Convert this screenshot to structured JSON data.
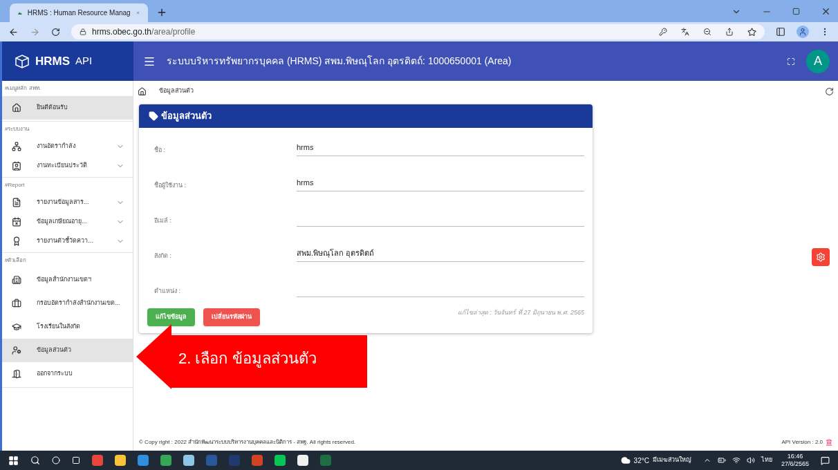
{
  "browser": {
    "tab_title": "HRMS : Human Resource Manag",
    "url_host": "hrms.obec.go.th",
    "url_path": "/area/profile"
  },
  "header": {
    "logo": "HRMS",
    "logo_suffix": "API",
    "title": "ระบบบริหารทรัพยากรบุคคล (HRMS) สพม.พิษณุโลก อุตรดิตถ์: 1000650001 (Area)",
    "avatar": "A"
  },
  "sidebar": [
    {
      "heading": "#เมนูหลัก สพท.",
      "items": [
        {
          "label": "ยินดีต้อนรับ",
          "selected": true,
          "expandable": false
        }
      ]
    },
    {
      "heading": "#ระบบงาน",
      "items": [
        {
          "label": "งานอัตรากำลัง",
          "selected": false,
          "expandable": true
        },
        {
          "label": "งานทะเบียนประวัติ",
          "selected": false,
          "expandable": true
        }
      ]
    },
    {
      "heading": "#Report",
      "items": [
        {
          "label": "รายงานข้อมูลสาร...",
          "selected": false,
          "expandable": true
        },
        {
          "label": "ข้อมูลเกษียณอายุ...",
          "selected": false,
          "expandable": true
        },
        {
          "label": "รายงานตัวชี้วัดควา...",
          "selected": false,
          "expandable": true
        }
      ]
    },
    {
      "heading": "#ตัวเลือก",
      "items": [
        {
          "label": "ข้อมูลสำนักงานเขตฯ",
          "selected": false,
          "expandable": false
        },
        {
          "label": "กรอบอัตรากำลังสำนักงานเขต...",
          "selected": false,
          "expandable": false
        },
        {
          "label": "โรงเรียนในสังกัด",
          "selected": false,
          "expandable": false
        },
        {
          "label": "ข้อมูลส่วนตัว",
          "selected": true,
          "expandable": false
        },
        {
          "label": "ออกจากระบบ",
          "selected": false,
          "expandable": false
        }
      ]
    }
  ],
  "breadcrumb": "ข้อมูลส่วนตัว",
  "card": {
    "title": "ข้อมูลส่วนตัว",
    "fields": [
      {
        "label": "ชื่อ :",
        "value": "hrms"
      },
      {
        "label": "ชื่อผู้ใช้งาน :",
        "value": "hrms"
      },
      {
        "label": "อีเมล์ :"
      },
      {
        "label": "สังกัด :",
        "value": "สพม.พิษณุโลก อุตรดิตถ์"
      },
      {
        "label": "ตำแหน่ง :"
      }
    ],
    "buttons": [
      {
        "label": "แก้ไขข้อมูล",
        "kind": "primary"
      },
      {
        "label": "เปลี่ยนรหัสผ่าน",
        "kind": "danger"
      }
    ],
    "last_edited": "แก้ไขล่าสุด : วันจันทร์ ที่ 27 มิถุนายน พ.ศ. 2565"
  },
  "annotation": "2. เลือก ข้อมูลส่วนตัว",
  "footer": {
    "copyright": "© Copy right : 2022 สำนักพัฒนาระบบบริหารงานบุคคลและนิติการ - สพฐ. All rights reserved.",
    "api_version": "API Version : 2.0"
  },
  "taskbar": {
    "temperature": "32°C",
    "weather": "มีเมฆส่วนใหญ่",
    "language": "ไทย",
    "time": "16:46",
    "date": "27/6/2565"
  }
}
